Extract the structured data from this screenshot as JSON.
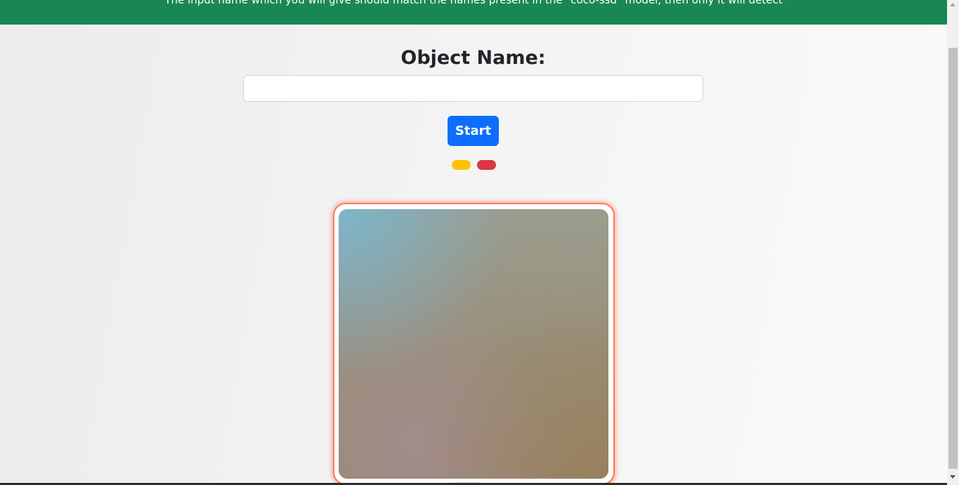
{
  "banner": {
    "text": "The input name which you will give should match the names present in the \"coco-ssd\" model, then only it will detect",
    "color": "#198754"
  },
  "form": {
    "title": "Object Name:",
    "input_value": "",
    "input_placeholder": ""
  },
  "controls": {
    "start_label": "Start",
    "start_color": "#0d6efd",
    "indicator_colors": [
      "#ffc107",
      "#dc3545"
    ]
  },
  "video": {
    "border_color": "#ff7a59"
  }
}
